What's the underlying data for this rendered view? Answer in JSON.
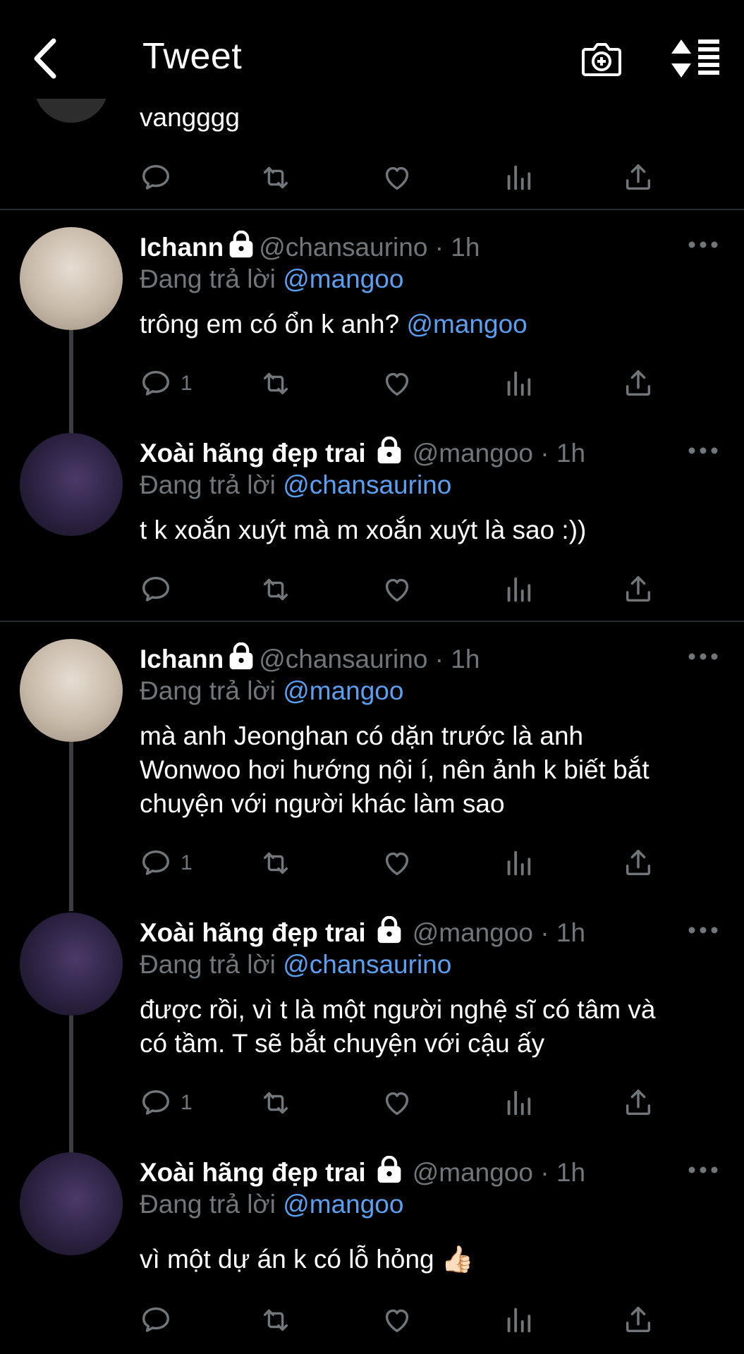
{
  "header": {
    "title": "Tweet",
    "back_icon": "chevron-left-icon",
    "camera_icon": "camera-add-icon",
    "sort_icon": "sort-icon"
  },
  "partial_tweet": {
    "text": "vangggg"
  },
  "colors": {
    "background": "#000000",
    "mention": "#5b9ff0",
    "muted": "#71767b",
    "divider": "#2a2d31"
  },
  "tweets": [
    {
      "name": "Ichann",
      "handle": "@chansaurino",
      "time": "1h",
      "reply_prefix": "Đang trả lời",
      "reply_to": "@mangoo",
      "text": "trông em có ổn k anh?",
      "text_mention": "@mangoo",
      "reply_count": "1"
    },
    {
      "name": "Xoài hãng đẹp trai",
      "handle": "@mangoo",
      "time": "1h",
      "reply_prefix": "Đang trả lời",
      "reply_to": "@chansaurino",
      "text": "t k xoắn xuýt mà m xoắn xuýt là sao :))",
      "reply_count": ""
    },
    {
      "name": "Ichann",
      "handle": "@chansaurino",
      "time": "1h",
      "reply_prefix": "Đang trả lời",
      "reply_to": "@mangoo",
      "text_line1": "mà anh Jeonghan có dặn trước là anh",
      "text_line2": "Wonwoo hơi hướng nội í, nên ảnh k biết bắt",
      "text_line3": "chuyện với người khác làm sao",
      "reply_count": "1"
    },
    {
      "name": "Xoài hãng đẹp trai",
      "handle": "@mangoo",
      "time": "1h",
      "reply_prefix": "Đang trả lời",
      "reply_to": "@chansaurino",
      "text_line1": "được rồi, vì t là một người nghệ sĩ có tâm và",
      "text_line2": "có tầm. T sẽ bắt chuyện với cậu ấy",
      "reply_count": "1"
    },
    {
      "name": "Xoài hãng đẹp trai",
      "handle": "@mangoo",
      "time": "1h",
      "reply_prefix": "Đang trả lời",
      "reply_to": "@mangoo",
      "text": "vì một dự án k có lỗ hỏng 👍🏻",
      "reply_count": ""
    }
  ],
  "dot": "·"
}
